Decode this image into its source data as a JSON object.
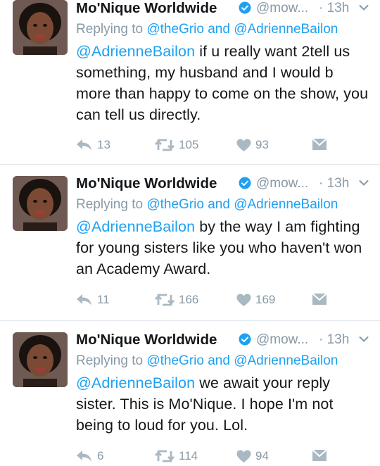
{
  "tweets": [
    {
      "name": "Mo'Nique Worldwide",
      "handle": "@mow...",
      "time": "· 13h",
      "replying_prefix": "Replying to",
      "replying_to_1": "@theGrio",
      "replying_and": "and",
      "replying_to_2": "@AdrienneBailon",
      "mention": "@AdrienneBailon",
      "body": " if u really want 2tell us something, my husband and I would b more than happy to come on the show, you can tell us directly.",
      "replies": "13",
      "retweets": "105",
      "likes": "93"
    },
    {
      "name": "Mo'Nique Worldwide",
      "handle": "@mow...",
      "time": "· 13h",
      "replying_prefix": "Replying to",
      "replying_to_1": "@theGrio",
      "replying_and": "and",
      "replying_to_2": "@AdrienneBailon",
      "mention": "@AdrienneBailon",
      "body": " by the way I am fighting for young sisters like you who haven't won an Academy Award.",
      "replies": "11",
      "retweets": "166",
      "likes": "169"
    },
    {
      "name": "Mo'Nique Worldwide",
      "handle": "@mow...",
      "time": "· 13h",
      "replying_prefix": "Replying to",
      "replying_to_1": "@theGrio",
      "replying_and": "and",
      "replying_to_2": "@AdrienneBailon",
      "mention": "@AdrienneBailon",
      "body": " we await your reply sister. This is Mo'Nique. I hope I'm not being to loud for you. Lol.",
      "replies": "6",
      "retweets": "114",
      "likes": "94"
    }
  ],
  "colors": {
    "link": "#1da1f2",
    "meta": "#8899a6",
    "text": "#14171a",
    "verified": "#1da1f2"
  },
  "icons": [
    "verified-badge-icon",
    "chevron-down-icon",
    "reply-icon",
    "retweet-icon",
    "heart-icon",
    "direct-message-icon"
  ]
}
